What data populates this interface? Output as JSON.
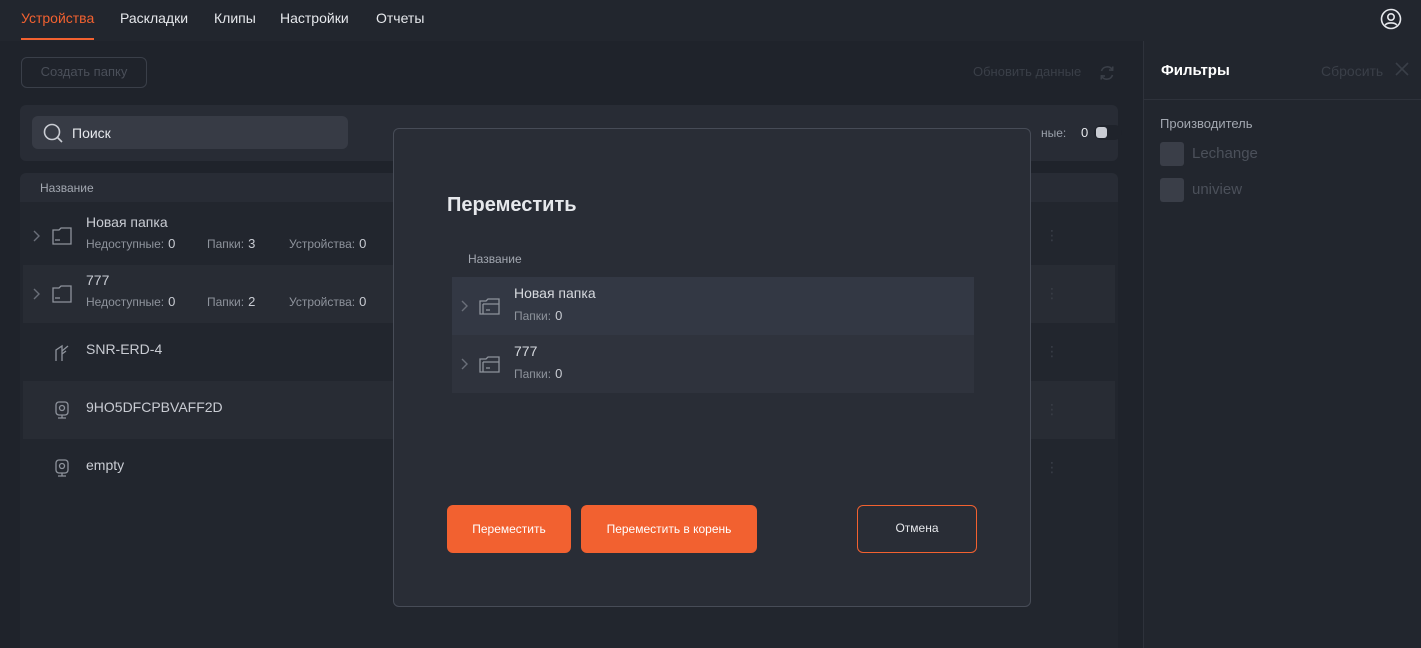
{
  "nav": {
    "tabs": [
      {
        "label": "Устройства",
        "active": true
      },
      {
        "label": "Раскладки",
        "active": false
      },
      {
        "label": "Клипы",
        "active": false
      },
      {
        "label": "Настройки",
        "active": false
      },
      {
        "label": "Отчеты",
        "active": false
      }
    ],
    "profile_icon": "user-circle-icon"
  },
  "main": {
    "create_folder_label": "Создать папку",
    "refresh_label": "Обновить данные",
    "search": {
      "placeholder": "Поиск"
    },
    "toggle": {
      "label": "ные:",
      "count": "0"
    },
    "column_name": "Название",
    "rows": [
      {
        "name": "Новая папка",
        "type": "folder",
        "unavailable_label": "Недоступные:",
        "unavailable": "0",
        "folders_label": "Папки:",
        "folders": "3",
        "devices_label": "Устройства:",
        "devices": "0"
      },
      {
        "name": "777",
        "type": "folder",
        "unavailable_label": "Недоступные:",
        "unavailable": "0",
        "folders_label": "Папки:",
        "folders": "2",
        "devices_label": "Устройства:",
        "devices": "0"
      },
      {
        "name": "SNR-ERD-4",
        "type": "device"
      },
      {
        "name": "9HO5DFCPBVAFF2D",
        "type": "camera"
      },
      {
        "name": "empty",
        "type": "camera"
      }
    ]
  },
  "filters": {
    "title": "Фильтры",
    "reset_label": "Сбросить",
    "group_label": "Производитель",
    "options": [
      {
        "label": "Lechange",
        "checked": false
      },
      {
        "label": "uniview",
        "checked": false
      }
    ]
  },
  "modal": {
    "title": "Переместить",
    "column_name": "Название",
    "rows": [
      {
        "name": "Новая папка",
        "folders_label": "Папки:",
        "folders": "0"
      },
      {
        "name": "777",
        "folders_label": "Папки:",
        "folders": "0"
      }
    ],
    "move_label": "Переместить",
    "move_root_label": "Переместить в корень",
    "cancel_label": "Отмена"
  },
  "colors": {
    "accent": "#f26130",
    "background": "#1f232b",
    "panel": "#282c35"
  }
}
